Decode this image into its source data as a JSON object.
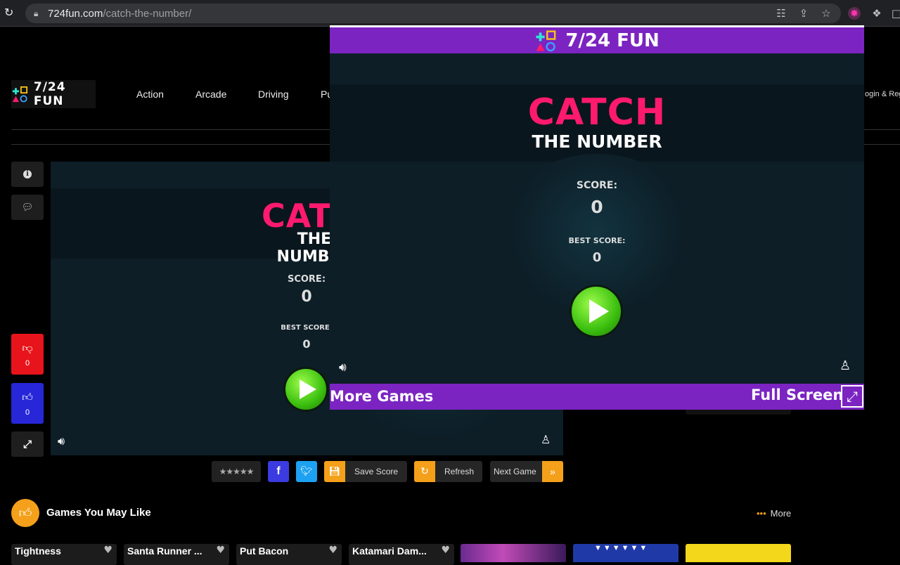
{
  "browser": {
    "url_domain": "724fun.com",
    "url_path": "/catch-the-number/"
  },
  "site": {
    "brand": "7/24 FUN",
    "nav": [
      "Action",
      "Arcade",
      "Driving",
      "Pu"
    ],
    "login": "ogin & Reg"
  },
  "side": {
    "dislike_count": "0",
    "like_count": "0"
  },
  "game": {
    "title_top": "CATCH",
    "title_bottom": "THE NUMBER",
    "score_label": "SCORE:",
    "score_value": "0",
    "best_label": "BEST SCORE:",
    "best_value": "0"
  },
  "toolbar": {
    "save_label": "Save Score",
    "refresh_label": "Refresh",
    "next_label": "Next Game",
    "next_arrow": "»"
  },
  "related": {
    "heading": "Games You May Like",
    "more_label": "More",
    "cards": [
      "Tightness",
      "Santa Runner ...",
      "Put Bacon",
      "Katamari Dam..."
    ]
  },
  "popup": {
    "brand": "7/24 FUN",
    "more_games": "More Games",
    "full_screen": "Full Screen"
  },
  "colors": {
    "purple": "#7b24c1",
    "pink": "#ff1a6e",
    "orange": "#f5a01a",
    "dislike_red": "#e8141b",
    "like_blue": "#2727d8"
  }
}
